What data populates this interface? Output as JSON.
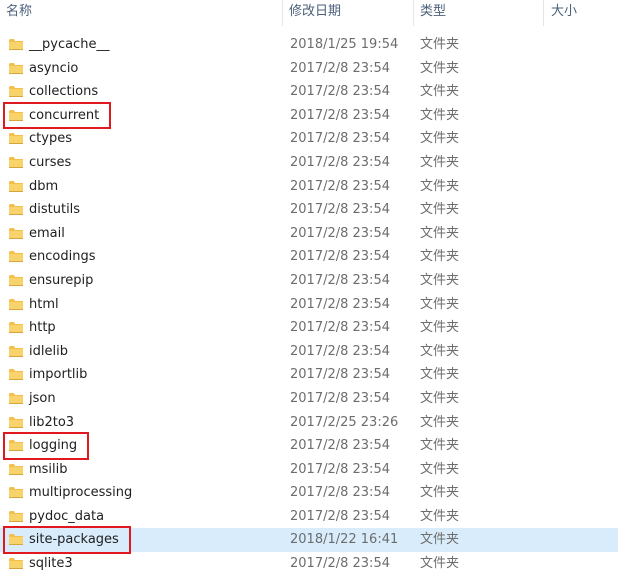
{
  "columns": {
    "name": "名称",
    "modified": "修改日期",
    "type": "类型",
    "size": "大小"
  },
  "files": [
    {
      "name": "__pycache__",
      "modified": "2018/1/25 19:54",
      "type": "文件夹"
    },
    {
      "name": "asyncio",
      "modified": "2017/2/8 23:54",
      "type": "文件夹"
    },
    {
      "name": "collections",
      "modified": "2017/2/8 23:54",
      "type": "文件夹"
    },
    {
      "name": "concurrent",
      "modified": "2017/2/8 23:54",
      "type": "文件夹"
    },
    {
      "name": "ctypes",
      "modified": "2017/2/8 23:54",
      "type": "文件夹"
    },
    {
      "name": "curses",
      "modified": "2017/2/8 23:54",
      "type": "文件夹"
    },
    {
      "name": "dbm",
      "modified": "2017/2/8 23:54",
      "type": "文件夹"
    },
    {
      "name": "distutils",
      "modified": "2017/2/8 23:54",
      "type": "文件夹"
    },
    {
      "name": "email",
      "modified": "2017/2/8 23:54",
      "type": "文件夹"
    },
    {
      "name": "encodings",
      "modified": "2017/2/8 23:54",
      "type": "文件夹"
    },
    {
      "name": "ensurepip",
      "modified": "2017/2/8 23:54",
      "type": "文件夹"
    },
    {
      "name": "html",
      "modified": "2017/2/8 23:54",
      "type": "文件夹"
    },
    {
      "name": "http",
      "modified": "2017/2/8 23:54",
      "type": "文件夹"
    },
    {
      "name": "idlelib",
      "modified": "2017/2/8 23:54",
      "type": "文件夹"
    },
    {
      "name": "importlib",
      "modified": "2017/2/8 23:54",
      "type": "文件夹"
    },
    {
      "name": "json",
      "modified": "2017/2/8 23:54",
      "type": "文件夹"
    },
    {
      "name": "lib2to3",
      "modified": "2017/2/25 23:26",
      "type": "文件夹"
    },
    {
      "name": "logging",
      "modified": "2017/2/8 23:54",
      "type": "文件夹"
    },
    {
      "name": "msilib",
      "modified": "2017/2/8 23:54",
      "type": "文件夹"
    },
    {
      "name": "multiprocessing",
      "modified": "2017/2/8 23:54",
      "type": "文件夹"
    },
    {
      "name": "pydoc_data",
      "modified": "2017/2/8 23:54",
      "type": "文件夹"
    },
    {
      "name": "site-packages",
      "modified": "2018/1/22 16:41",
      "type": "文件夹",
      "selected": true
    },
    {
      "name": "sqlite3",
      "modified": "2017/2/8 23:54",
      "type": "文件夹"
    }
  ],
  "highlighted": [
    "concurrent",
    "logging",
    "site-packages"
  ],
  "colors": {
    "selection": "#d9ecfb",
    "highlight_box": "#e0191f",
    "folder": "#f4c04b",
    "header_text": "#4c607a"
  },
  "icons": {
    "folder": "folder-icon"
  }
}
